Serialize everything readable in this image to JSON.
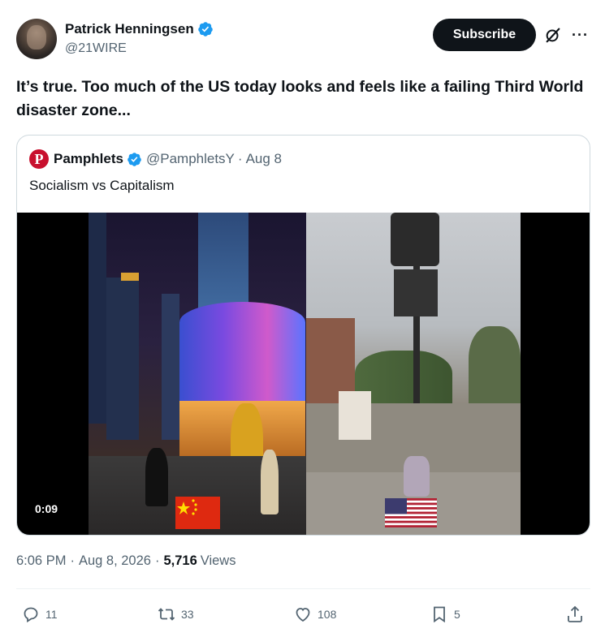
{
  "author": {
    "name": "Patrick Henningsen",
    "handle": "@21WIRE",
    "verified_color": "#1d9bf0"
  },
  "header": {
    "subscribe_label": "Subscribe",
    "grok_icon": "grok-icon",
    "more_icon": "more-icon"
  },
  "tweet": {
    "text": "It’s true. Too much of the US today looks and feels like a failing Third World disaster zone..."
  },
  "quote": {
    "avatar_letter": "P",
    "avatar_color": "#c8102e",
    "name": "Pamphlets",
    "handle": "@PamphletsY",
    "separator": "·",
    "date": "Aug 8",
    "text": "Socialism vs Capitalism",
    "video": {
      "duration": "0:09",
      "left_flag": "china-flag",
      "right_flag": "us-flag"
    }
  },
  "meta": {
    "time": "6:06 PM",
    "date": "Aug 8, 2026",
    "views_count": "5,716",
    "views_label": "Views",
    "separator": "·"
  },
  "actions": {
    "replies": "11",
    "reposts": "33",
    "likes": "108",
    "bookmarks": "5"
  }
}
